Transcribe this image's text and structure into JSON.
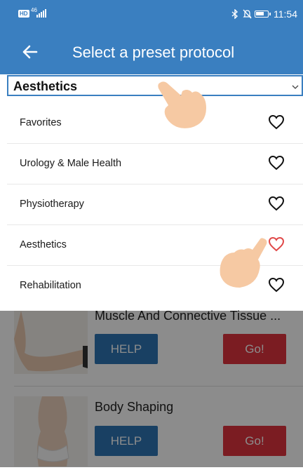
{
  "status_bar": {
    "hd_badge": "HD",
    "network": "46",
    "time": "11:54",
    "battery_level": 0.7
  },
  "app_bar": {
    "back_icon": "arrow-left-icon",
    "title": "Select a preset protocol"
  },
  "dropdown": {
    "selected": "Aesthetics",
    "icon": "chevron-down-icon"
  },
  "categories": [
    {
      "label": "Favorites",
      "favorited": false
    },
    {
      "label": "Urology & Male Health",
      "favorited": false
    },
    {
      "label": "Physiotherapy",
      "favorited": false
    },
    {
      "label": "Aesthetics",
      "favorited": true
    },
    {
      "label": "Rehabilitation",
      "favorited": false
    }
  ],
  "protocols": [
    {
      "title": "Muscle And Connective Tissue ...",
      "help_label": "HELP",
      "go_label": "Go!"
    },
    {
      "title": "Body Shaping",
      "help_label": "HELP",
      "go_label": "Go!"
    }
  ],
  "colors": {
    "primary": "#3a7fc0",
    "go_red": "#e0333f",
    "favorite_red": "#e04848"
  }
}
